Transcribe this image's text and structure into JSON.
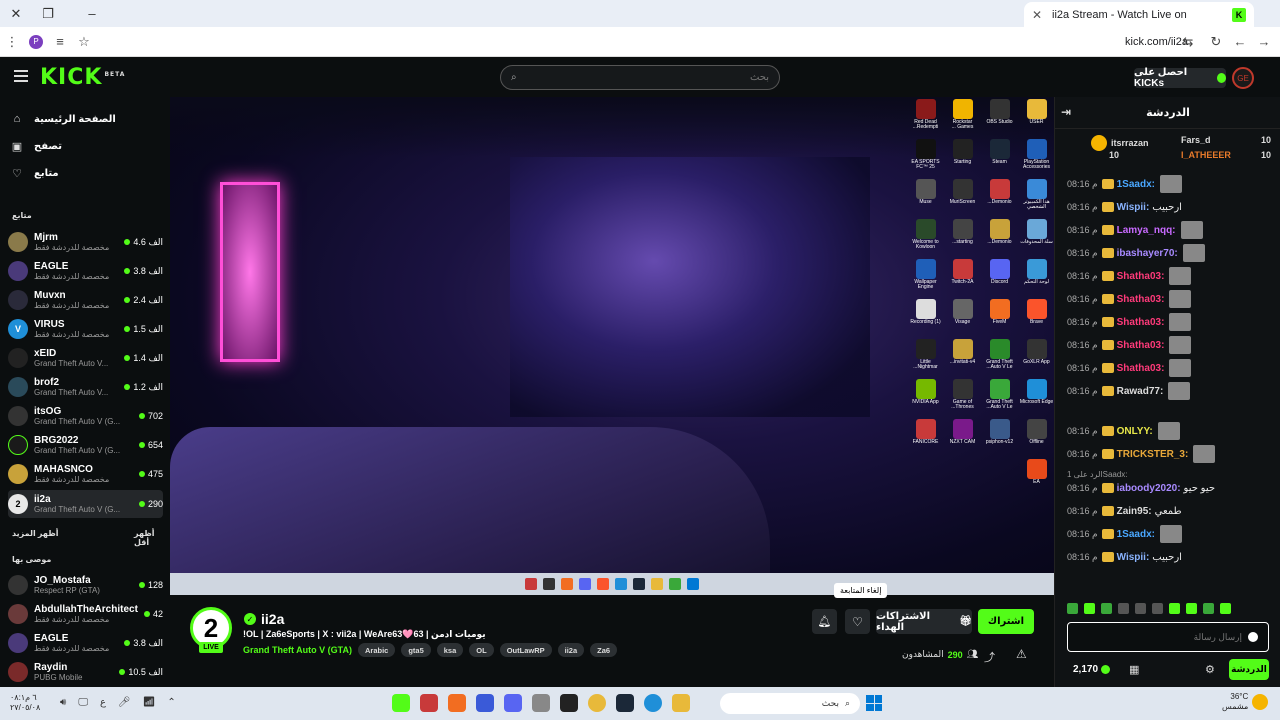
{
  "browser": {
    "tab_title": "ii2a Stream - Watch Live on",
    "favicon": "K",
    "url": "kick.com/ii2a",
    "profile_letter": "P"
  },
  "header": {
    "logo": "KICK",
    "logo_sup": "BETA",
    "search_placeholder": "بحث",
    "get_kicks": "احصل على KICKs",
    "user_avatar": "GE"
  },
  "sidebar": {
    "nav": [
      {
        "label": "الصفحة الرئيسية",
        "icon": "home-icon"
      },
      {
        "label": "تصفح",
        "icon": "browse-icon"
      },
      {
        "label": "متابع",
        "icon": "heart-icon"
      }
    ],
    "following_title": "متابع",
    "channels": [
      {
        "name": "Mjrm",
        "category": "مخصصة للدردشة فقط",
        "views": "4.6 الف",
        "color": "#8a7a4a"
      },
      {
        "name": "EAGLE",
        "category": "مخصصة للدردشة فقط",
        "views": "3.8 الف",
        "color": "#4a3a7a"
      },
      {
        "name": "Muvxn",
        "category": "مخصصة للدردشة فقط",
        "views": "2.4 الف",
        "color": "#2a2a3a"
      },
      {
        "name": "VIRUS",
        "category": "مخصصة للدردشة فقط",
        "views": "1.5 الف",
        "color": "#1f8fd8"
      },
      {
        "name": "xEID",
        "category": "Grand Theft Auto V...",
        "views": "1.4 الف",
        "color": "#222"
      },
      {
        "name": "brof2",
        "category": "Grand Theft Auto V...",
        "views": "1.2 الف",
        "color": "#2a4a5a"
      },
      {
        "name": "itsOG",
        "category": "Grand Theft Auto V (G...",
        "views": "702",
        "color": "#333"
      },
      {
        "name": "BRG2022",
        "category": "Grand Theft Auto V (G...",
        "views": "654",
        "color": "#1a1a1a"
      },
      {
        "name": "MAHASNCO",
        "category": "مخصصة للدردشة فقط",
        "views": "475",
        "color": "#c8a23a"
      },
      {
        "name": "ii2a",
        "category": "Grand Theft Auto V (G...",
        "views": "290",
        "color": "#e8e8e8"
      }
    ],
    "show_more": "أظهر المزيد",
    "show_less": "أظهر أقل",
    "recommended_title": "موصى بها",
    "recommended": [
      {
        "name": "JO_Mostafa",
        "category": "Respect RP (GTA)",
        "views": "128",
        "color": "#333"
      },
      {
        "name": "AbdullahTheArchitect",
        "category": "مخصصة للدردشة فقط",
        "views": "42",
        "color": "#6a3a3a"
      },
      {
        "name": "EAGLE",
        "category": "مخصصة للدردشة فقط",
        "views": "3.8 الف",
        "color": "#4a3a7a"
      },
      {
        "name": "Raydin",
        "category": "PUBG Mobile",
        "views": "10.5 الف",
        "color": "#7a2a2a"
      }
    ]
  },
  "desktop_icons": [
    {
      "label": "USER",
      "color": "#e8b93a"
    },
    {
      "label": "OBS Studio",
      "color": "#333"
    },
    {
      "label": "Rockstar Games ...",
      "color": "#f0b400"
    },
    {
      "label": "Red Dead Redempti...",
      "color": "#8a1a1a"
    },
    {
      "label": "PlayStation Accessories",
      "color": "#1f5fb8"
    },
    {
      "label": "Steam",
      "color": "#1b2838"
    },
    {
      "label": "Starting",
      "color": "#222"
    },
    {
      "label": "EA SPORTS FC™ 25",
      "color": "#111"
    },
    {
      "label": "هذا الكمبيوتر الشخصي",
      "color": "#3a8ad8"
    },
    {
      "label": "Demonio...",
      "color": "#c83a3a"
    },
    {
      "label": "MuriScreen",
      "color": "#333"
    },
    {
      "label": "Muse",
      "color": "#555"
    },
    {
      "label": "سلة المحذوفات",
      "color": "#6aa8d8"
    },
    {
      "label": "Demonio...",
      "color": "#c8a23a"
    },
    {
      "label": "starting...",
      "color": "#444"
    },
    {
      "label": "Welcome to Kowloon",
      "color": "#2a4a2a"
    },
    {
      "label": "لوحة التحكم",
      "color": "#3a9ad8"
    },
    {
      "label": "Discord",
      "color": "#5865f2"
    },
    {
      "label": "Twitch-2A",
      "color": "#c83a3a"
    },
    {
      "label": "Wallpaper Engine",
      "color": "#1f5fb8"
    },
    {
      "label": "Brave",
      "color": "#fb542b"
    },
    {
      "label": "FiveM",
      "color": "#f26d21"
    },
    {
      "label": "Visage",
      "color": "#666"
    },
    {
      "label": "Recording (1)",
      "color": "#ddd"
    },
    {
      "label": "GoXLR App",
      "color": "#333"
    },
    {
      "label": "Grand Theft Auto V Le...",
      "color": "#2a8a2a"
    },
    {
      "label": "invitati-v4...",
      "color": "#c8a23a"
    },
    {
      "label": "Little Nightmar...",
      "color": "#222"
    },
    {
      "label": "Microsoft Edge",
      "color": "#1f8fd8"
    },
    {
      "label": "Grand Theft Auto V Le...",
      "color": "#3aa83a"
    },
    {
      "label": "Game of Thrones...",
      "color": "#333"
    },
    {
      "label": "NVIDIA App",
      "color": "#76b900"
    },
    {
      "label": "Offline",
      "color": "#444"
    },
    {
      "label": "psiphon-v12",
      "color": "#3a5a8a"
    },
    {
      "label": "NZXT CAM",
      "color": "#7a1a8a"
    },
    {
      "label": "FANICORE",
      "color": "#c83a3a"
    },
    {
      "label": "EA",
      "color": "#e84a1a"
    }
  ],
  "stream": {
    "avatar": "2",
    "live_label": "LIVE",
    "channel_name": "ii2a",
    "title": "!OL | Za6eSports | X : vii2a | WeAre63🩷63 | يوميات ادمن",
    "category": "Grand Theft Auto V (GTA)",
    "tags": [
      "Arabic",
      "gta5",
      "ksa",
      "OL",
      "OutLawRP",
      "ii2a",
      "Za6"
    ],
    "subscribe": "اشتراك",
    "gift_subs": "الاشتراكات الهداء",
    "unfollow_tooltip": "إلغاء المتابعة",
    "viewers_label": "المشاهدون",
    "viewers_count": "290"
  },
  "chat": {
    "title": "الدردشة",
    "pinned": [
      {
        "name": "itsrrazan",
        "count": "10",
        "color": "#ddd"
      },
      {
        "name": "Fars_d",
        "count": "10",
        "color": "#ddd"
      },
      {
        "name": "I_ATHEEER",
        "count": "10",
        "color": "#e87a2a"
      }
    ],
    "messages": [
      {
        "time": "08:16 م",
        "user": "1Saadx:",
        "text": "",
        "color": "#4aa8ff"
      },
      {
        "time": "08:16 م",
        "user": "Wispii:",
        "text": "ارحبيب",
        "color": "#8ab4ff"
      },
      {
        "time": "08:16 م",
        "user": "Lamya_nqq:",
        "text": "",
        "color": "#c86aff"
      },
      {
        "time": "08:16 م",
        "user": "ibashayer70:",
        "text": "",
        "color": "#a88aff"
      },
      {
        "time": "08:16 م",
        "user": "Shatha03:",
        "text": "",
        "color": "#ff3a7a"
      },
      {
        "time": "08:16 م",
        "user": "Shatha03:",
        "text": "",
        "color": "#ff3a7a"
      },
      {
        "time": "08:16 م",
        "user": "Shatha03:",
        "text": "",
        "color": "#ff3a7a"
      },
      {
        "time": "08:16 م",
        "user": "Shatha03:",
        "text": "",
        "color": "#ff3a7a"
      },
      {
        "time": "08:16 م",
        "user": "Shatha03:",
        "text": "",
        "color": "#ff3a7a"
      },
      {
        "time": "08:16 م",
        "user": "Rawad77:",
        "text": "",
        "color": "#ddd"
      },
      {
        "time": "08:16 م",
        "user": "ONLYY:",
        "text": "",
        "color": "#e8e84a"
      },
      {
        "time": "08:16 م",
        "user": "TRICKSTER_3:",
        "text": "",
        "color": "#e8a83a"
      },
      {
        "time": "08:16 م",
        "user": "iaboody2020:",
        "text": "حيو حيو",
        "color": "#a88aff"
      },
      {
        "time": "08:16 م",
        "user": "Zain95:",
        "text": "طمعي",
        "color": "#ddd"
      },
      {
        "time": "08:16 م",
        "user": "1Saadx:",
        "text": "",
        "color": "#4aa8ff"
      },
      {
        "time": "08:16 م",
        "user": "Wispii:",
        "text": "ارحبيب",
        "color": "#8ab4ff"
      }
    ],
    "reply_to": "الرد على 1Saadx:",
    "input_placeholder": "إرسال رسالة",
    "kicks": "2,170",
    "chat_button": "الدردشة"
  },
  "taskbar": {
    "time": "۰۸:۱٦ م",
    "date": "۲۷/۰٥/۰۸",
    "search_placeholder": "بحث",
    "temp": "36°C",
    "weather": "مشمس"
  },
  "colors": {
    "accent": "#53fc18",
    "bg": "#0b0e0f"
  }
}
